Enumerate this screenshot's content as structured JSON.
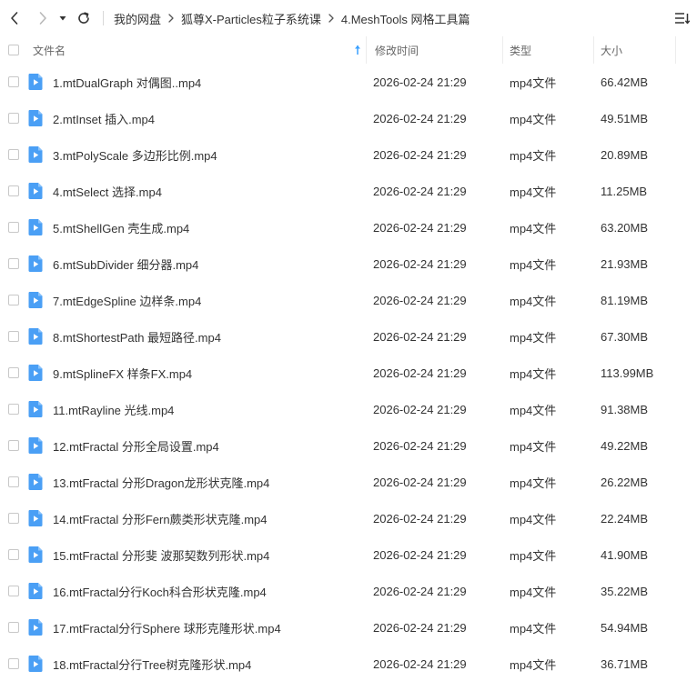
{
  "breadcrumb": [
    "我的网盘",
    "狐尊X-Particles粒子系统课",
    "4.MeshTools 网格工具篇"
  ],
  "columns": {
    "name": "文件名",
    "modified": "修改时间",
    "type": "类型",
    "size": "大小"
  },
  "icons": {
    "back": "chevron-left-icon",
    "forward": "chevron-right-icon",
    "history": "caret-down-icon",
    "refresh": "refresh-icon",
    "view": "list-view-icon",
    "sort": "sort-ascending-icon",
    "file": "video-file-icon"
  },
  "colors": {
    "accent": "#3aa0ff",
    "file_icon": "#4a9ff5",
    "text": "#333333",
    "header_text": "#666666"
  },
  "files": [
    {
      "name": "1.mtDualGraph  对偶图..mp4",
      "modified": "2026-02-24 21:29",
      "type": "mp4文件",
      "size": "66.42MB"
    },
    {
      "name": "2.mtInset 插入.mp4",
      "modified": "2026-02-24 21:29",
      "type": "mp4文件",
      "size": "49.51MB"
    },
    {
      "name": "3.mtPolyScale 多边形比例.mp4",
      "modified": "2026-02-24 21:29",
      "type": "mp4文件",
      "size": "20.89MB"
    },
    {
      "name": "4.mtSelect 选择.mp4",
      "modified": "2026-02-24 21:29",
      "type": "mp4文件",
      "size": "11.25MB"
    },
    {
      "name": "5.mtShellGen 壳生成.mp4",
      "modified": "2026-02-24 21:29",
      "type": "mp4文件",
      "size": "63.20MB"
    },
    {
      "name": "6.mtSubDivider 细分器.mp4",
      "modified": "2026-02-24 21:29",
      "type": "mp4文件",
      "size": "21.93MB"
    },
    {
      "name": "7.mtEdgeSpline 边样条.mp4",
      "modified": "2026-02-24 21:29",
      "type": "mp4文件",
      "size": "81.19MB"
    },
    {
      "name": "8.mtShortestPath 最短路径.mp4",
      "modified": "2026-02-24 21:29",
      "type": "mp4文件",
      "size": "67.30MB"
    },
    {
      "name": "9.mtSplineFX 样条FX.mp4",
      "modified": "2026-02-24 21:29",
      "type": "mp4文件",
      "size": "113.99MB"
    },
    {
      "name": "11.mtRayline 光线.mp4",
      "modified": "2026-02-24 21:29",
      "type": "mp4文件",
      "size": "91.38MB"
    },
    {
      "name": "12.mtFractal 分形全局设置.mp4",
      "modified": "2026-02-24 21:29",
      "type": "mp4文件",
      "size": "49.22MB"
    },
    {
      "name": "13.mtFractal 分形Dragon龙形状克隆.mp4",
      "modified": "2026-02-24 21:29",
      "type": "mp4文件",
      "size": "26.22MB"
    },
    {
      "name": "14.mtFractal 分形Fern蕨类形状克隆.mp4",
      "modified": "2026-02-24 21:29",
      "type": "mp4文件",
      "size": "22.24MB"
    },
    {
      "name": "15.mtFractal 分形斐 波那契数列形状.mp4",
      "modified": "2026-02-24 21:29",
      "type": "mp4文件",
      "size": "41.90MB"
    },
    {
      "name": "16.mtFractal分行Koch科合形状克隆.mp4",
      "modified": "2026-02-24 21:29",
      "type": "mp4文件",
      "size": "35.22MB"
    },
    {
      "name": "17.mtFractal分行Sphere 球形克隆形状.mp4",
      "modified": "2026-02-24 21:29",
      "type": "mp4文件",
      "size": "54.94MB"
    },
    {
      "name": "18.mtFractal分行Tree树克隆形状.mp4",
      "modified": "2026-02-24 21:29",
      "type": "mp4文件",
      "size": "36.71MB"
    }
  ]
}
